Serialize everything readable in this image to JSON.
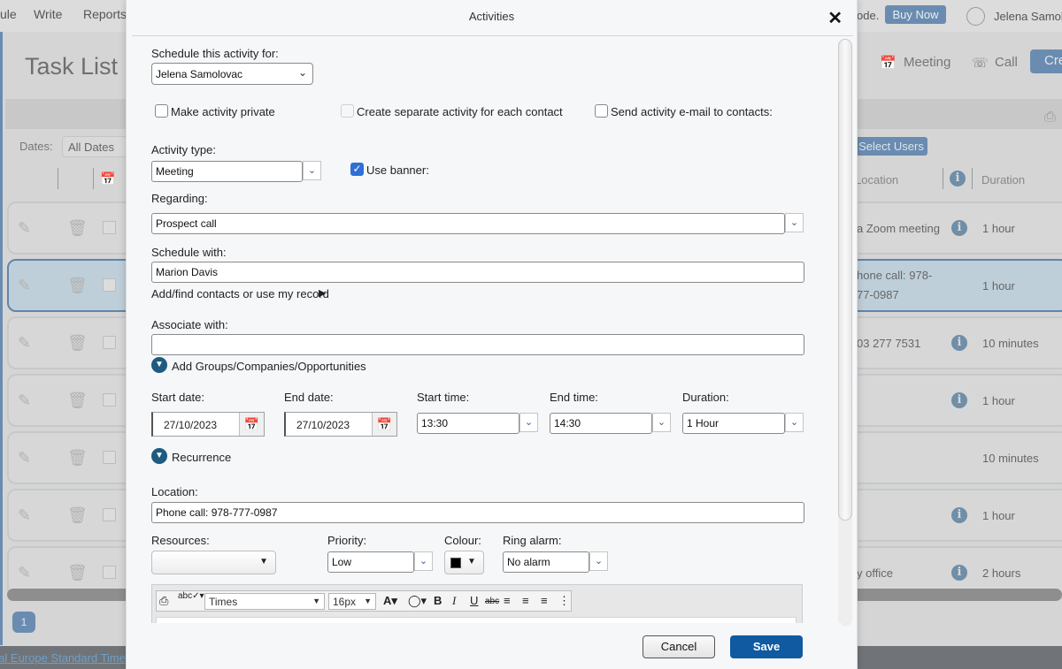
{
  "background": {
    "nav": [
      "ule",
      "Write",
      "Reports"
    ],
    "mode_text": "ode.",
    "buy_now": "Buy Now",
    "user_name": "Jelena Samolovac",
    "page_title": "Task List",
    "actions": {
      "meeting": "Meeting",
      "call": "Call",
      "create": "Create"
    },
    "dates_label": "Dates:",
    "dates_value": "All Dates",
    "select_users": "Select Users",
    "columns": {
      "location": "Location",
      "duration": "Duration"
    },
    "rows": [
      {
        "location": "a Zoom meeting",
        "info": true,
        "duration": "1 hour",
        "selected": false
      },
      {
        "location": "hone call: 978-",
        "location2": "77-0987",
        "info": false,
        "duration": "1 hour",
        "selected": true
      },
      {
        "location": "03 277 7531",
        "info": true,
        "duration": "10 minutes",
        "selected": false
      },
      {
        "location": "",
        "info": true,
        "duration": "1 hour",
        "selected": false
      },
      {
        "location": "",
        "info": false,
        "duration": "10 minutes",
        "selected": false
      },
      {
        "location": "",
        "info": true,
        "duration": "1 hour",
        "selected": false
      },
      {
        "location": "y office",
        "info": true,
        "duration": "2 hours",
        "selected": false
      }
    ],
    "page_number": "1",
    "timezone_link": "Central Europe Standard Time"
  },
  "modal": {
    "title": "Activities",
    "schedule_for_label": "Schedule this activity for:",
    "schedule_for_value": "Jelena Samolovac",
    "make_private_label": "Make activity private",
    "make_private_checked": false,
    "separate_activity_label": "Create separate activity for each contact",
    "separate_activity_checked": false,
    "send_email_label": "Send activity e-mail to contacts:",
    "send_email_checked": false,
    "activity_type_label": "Activity type:",
    "activity_type_value": "Meeting",
    "use_banner_label": "Use banner:",
    "use_banner_checked": true,
    "regarding_label": "Regarding:",
    "regarding_value": "Prospect call",
    "schedule_with_label": "Schedule with:",
    "schedule_with_value": "Marion Davis",
    "add_find_contacts": "Add/find contacts or use my record",
    "associate_label": "Associate with:",
    "associate_value": "",
    "add_groups": "Add Groups/Companies/Opportunities",
    "start_date_label": "Start date:",
    "start_date_value": "27/10/2023",
    "end_date_label": "End date:",
    "end_date_value": "27/10/2023",
    "start_time_label": "Start time:",
    "start_time_value": "13:30",
    "end_time_label": "End time:",
    "end_time_value": "14:30",
    "duration_label": "Duration:",
    "duration_value": "1 Hour",
    "recurrence": "Recurrence",
    "location_label": "Location:",
    "location_value": "Phone call: 978-777-0987",
    "resources_label": "Resources:",
    "resources_value": "",
    "priority_label": "Priority:",
    "priority_value": "Low",
    "colour_label": "Colour:",
    "colour_value": "#000000",
    "ring_alarm_label": "Ring alarm:",
    "ring_alarm_value": "No alarm",
    "editor": {
      "font": "Times",
      "size": "16px",
      "bold": "B",
      "italic": "I",
      "underline": "U",
      "strike": "abc"
    },
    "cancel": "Cancel",
    "save": "Save"
  }
}
